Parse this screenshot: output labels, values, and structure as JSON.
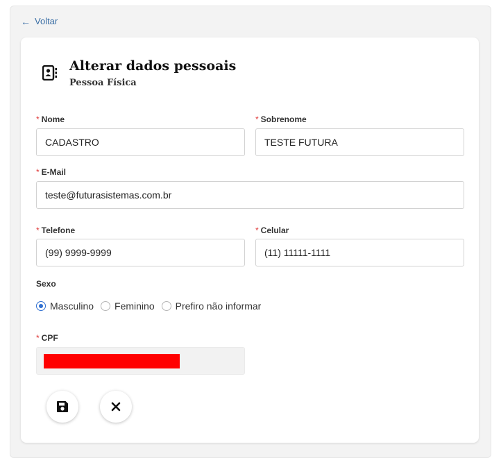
{
  "nav": {
    "back_label": "Voltar",
    "back_icon": "arrow-left-icon"
  },
  "header": {
    "title": "Alterar dados pessoais",
    "subtitle": "Pessoa Física",
    "icon": "contact-card-icon"
  },
  "form": {
    "required_mark": "*",
    "nome": {
      "label": "Nome",
      "value": "CADASTRO"
    },
    "sobrenome": {
      "label": "Sobrenome",
      "value": "TESTE FUTURA"
    },
    "email": {
      "label": "E-Mail",
      "value": "teste@futurasistemas.com.br"
    },
    "telefone": {
      "label": "Telefone",
      "value": "(99) 9999-9999"
    },
    "celular": {
      "label": "Celular",
      "value": "(11) 11111-1111"
    },
    "sexo": {
      "label": "Sexo",
      "options": [
        "Masculino",
        "Feminino",
        "Prefiro não informar"
      ],
      "selected": "Masculino"
    },
    "cpf": {
      "label": "CPF",
      "value": ""
    }
  },
  "actions": {
    "save_icon": "floppy-disk-icon",
    "cancel_icon": "close-icon"
  },
  "colors": {
    "accent": "#2f6fd1",
    "link": "#3a6ea5",
    "required": "#e03b3b",
    "redaction": "#ff0000"
  }
}
